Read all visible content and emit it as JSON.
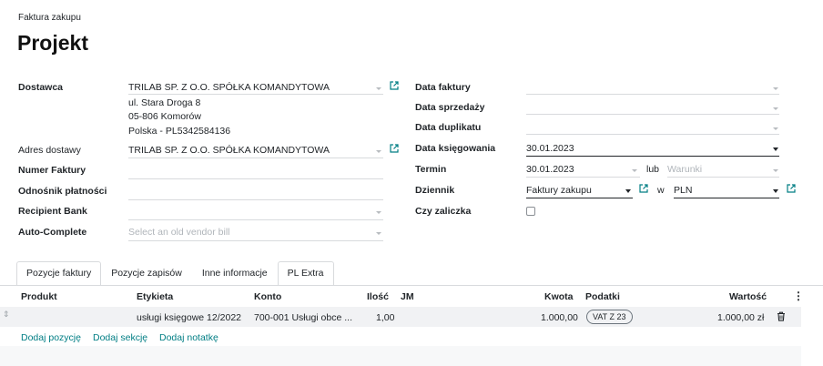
{
  "breadcrumb": "Faktura zakupu",
  "title": "Projekt",
  "left_fields": {
    "vendor_label": "Dostawca",
    "vendor_value": "TRILAB SP. Z O.O. SPÓŁKA KOMANDYTOWA",
    "vendor_address": [
      "ul. Stara Droga 8",
      "05-806 Komorów",
      "Polska - PL5342584136"
    ],
    "delivery_label": "Adres dostawy",
    "delivery_value": "TRILAB SP. Z O.O. SPÓŁKA KOMANDYTOWA",
    "invoice_number_label": "Numer Faktury",
    "invoice_number_value": "",
    "payment_ref_label": "Odnośnik płatności",
    "payment_ref_value": "",
    "recipient_bank_label": "Recipient Bank",
    "recipient_bank_value": "",
    "autocomplete_label": "Auto-Complete",
    "autocomplete_placeholder": "Select an old vendor bill"
  },
  "right_fields": {
    "invoice_date_label": "Data faktury",
    "invoice_date_value": "",
    "sale_date_label": "Data sprzedaży",
    "sale_date_value": "",
    "duplicate_date_label": "Data duplikatu",
    "duplicate_date_value": "",
    "accounting_date_label": "Data księgowania",
    "accounting_date_value": "30.01.2023",
    "due_label": "Termin",
    "due_value": "30.01.2023",
    "or_label": "lub",
    "terms_placeholder": "Warunki",
    "journal_label": "Dziennik",
    "journal_value": "Faktury zakupu",
    "in_label": "w",
    "currency_value": "PLN",
    "advance_label": "Czy zaliczka"
  },
  "tabs": [
    "Pozycje faktury",
    "Pozycje zapisów",
    "Inne informacje",
    "PL Extra"
  ],
  "table": {
    "headers": {
      "product": "Produkt",
      "label": "Etykieta",
      "account": "Konto",
      "qty": "Ilość",
      "uom": "JM",
      "price": "Kwota",
      "taxes": "Podatki",
      "subtotal": "Wartość"
    },
    "rows": [
      {
        "product": "",
        "label": "usługi księgowe 12/2022",
        "account": "700-001 Usługi obce ...",
        "qty": "1,00",
        "uom": "",
        "price": "1.000,00",
        "tax": "VAT Z 23",
        "subtotal": "1.000,00 zł"
      }
    ]
  },
  "actions": [
    "Dodaj pozycję",
    "Dodaj sekcję",
    "Dodaj notatkę"
  ],
  "colors": {
    "accent": "#017e84",
    "text": "#212529",
    "border": "#d8dadd"
  }
}
